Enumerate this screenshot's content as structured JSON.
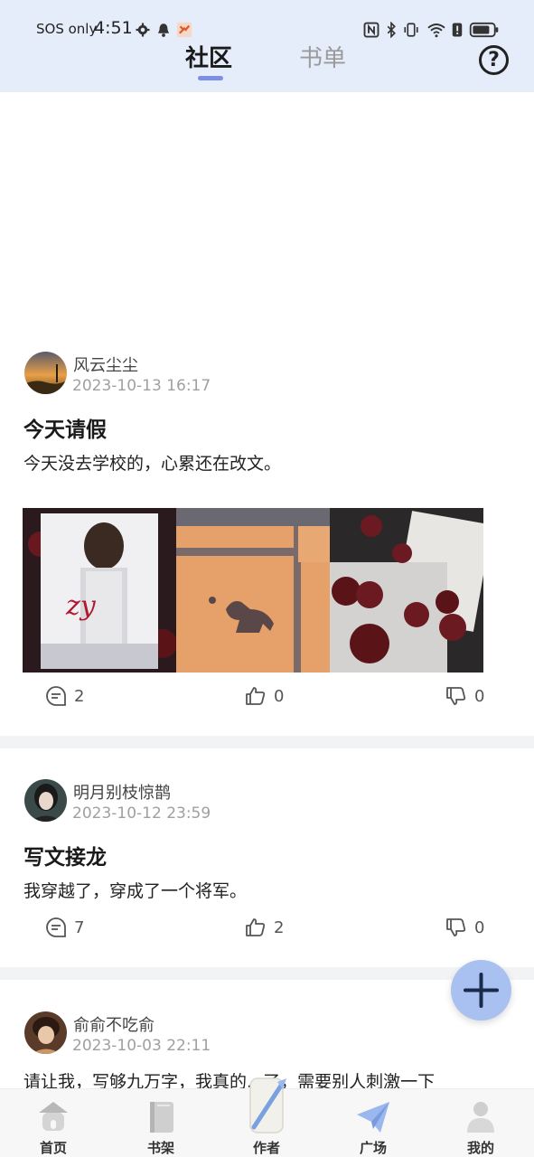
{
  "status_bar": {
    "sos": "SOS only",
    "time": "4:51",
    "icons": [
      "gear-icon",
      "bell-icon",
      "app-notification-icon",
      "nfc-icon",
      "bluetooth-icon",
      "vibrate-icon",
      "wifi-icon",
      "alert-icon",
      "battery-icon"
    ]
  },
  "header": {
    "tabs": [
      {
        "label": "社区",
        "active": true
      },
      {
        "label": "书单",
        "active": false
      }
    ],
    "help_symbol": "?"
  },
  "posts": [
    {
      "author": "风云尘尘",
      "date": "2023-10-13 16:17",
      "title": "今天请假",
      "body": "今天没去学校的，心累还在改文。",
      "images": [
        "book-cover-image",
        "window-shadow-dog-image",
        "roses-letters-image"
      ],
      "comments": "2",
      "likes": "0",
      "dislikes": "0"
    },
    {
      "author": "明月别枝惊鹊",
      "date": "2023-10-12 23:59",
      "title": "写文接龙",
      "body": "我穿越了，穿成了一个将军。",
      "comments": "7",
      "likes": "2",
      "dislikes": "0"
    },
    {
      "author": "俞俞不吃俞",
      "date": "2023-10-03 22:11",
      "body": "请让我，写够九万字，我真的...了，需要别人刺激一下"
    }
  ],
  "fab": {
    "icon": "plus-icon"
  },
  "bottom_nav": [
    {
      "label": "首页",
      "icon": "home-icon"
    },
    {
      "label": "书架",
      "icon": "bookshelf-icon"
    },
    {
      "label": "作者",
      "icon": "quill-scroll-icon"
    },
    {
      "label": "广场",
      "icon": "paper-plane-icon"
    },
    {
      "label": "我的",
      "icon": "profile-icon"
    }
  ],
  "colors": {
    "header_bg": "#e6edfa",
    "accent": "#7d8ee6",
    "fab_bg": "#a8c1f0",
    "separator": "#f2f3f5"
  }
}
